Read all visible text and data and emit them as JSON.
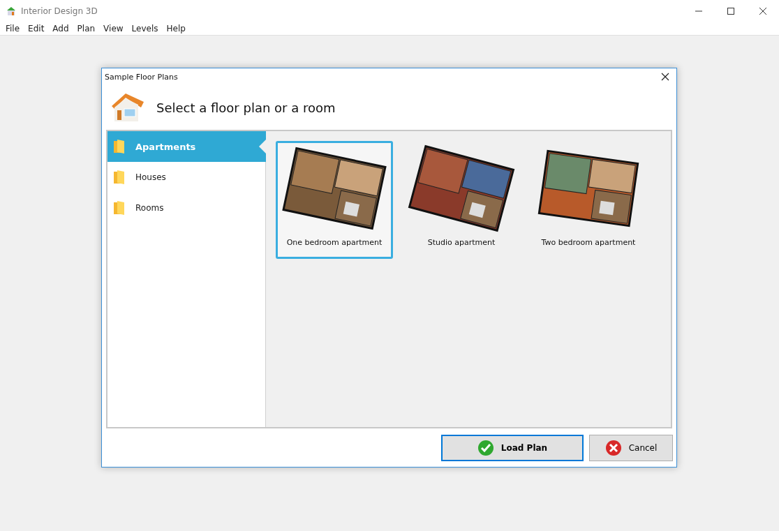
{
  "window": {
    "title": "Interior Design 3D"
  },
  "menu": [
    "File",
    "Edit",
    "Add",
    "Plan",
    "View",
    "Levels",
    "Help"
  ],
  "dialog": {
    "title": "Sample Floor Plans",
    "heading": "Select a floor plan or a room",
    "categories": [
      {
        "label": "Apartments",
        "selected": true
      },
      {
        "label": "Houses",
        "selected": false
      },
      {
        "label": "Rooms",
        "selected": false
      }
    ],
    "plans": [
      {
        "label": "One bedroom apartment",
        "selected": true
      },
      {
        "label": "Studio apartment",
        "selected": false
      },
      {
        "label": "Two bedroom apartment",
        "selected": false
      }
    ],
    "buttons": [
      {
        "label": "Load Plan",
        "kind": "ok"
      },
      {
        "label": "Cancel",
        "kind": "cancel"
      }
    ]
  }
}
